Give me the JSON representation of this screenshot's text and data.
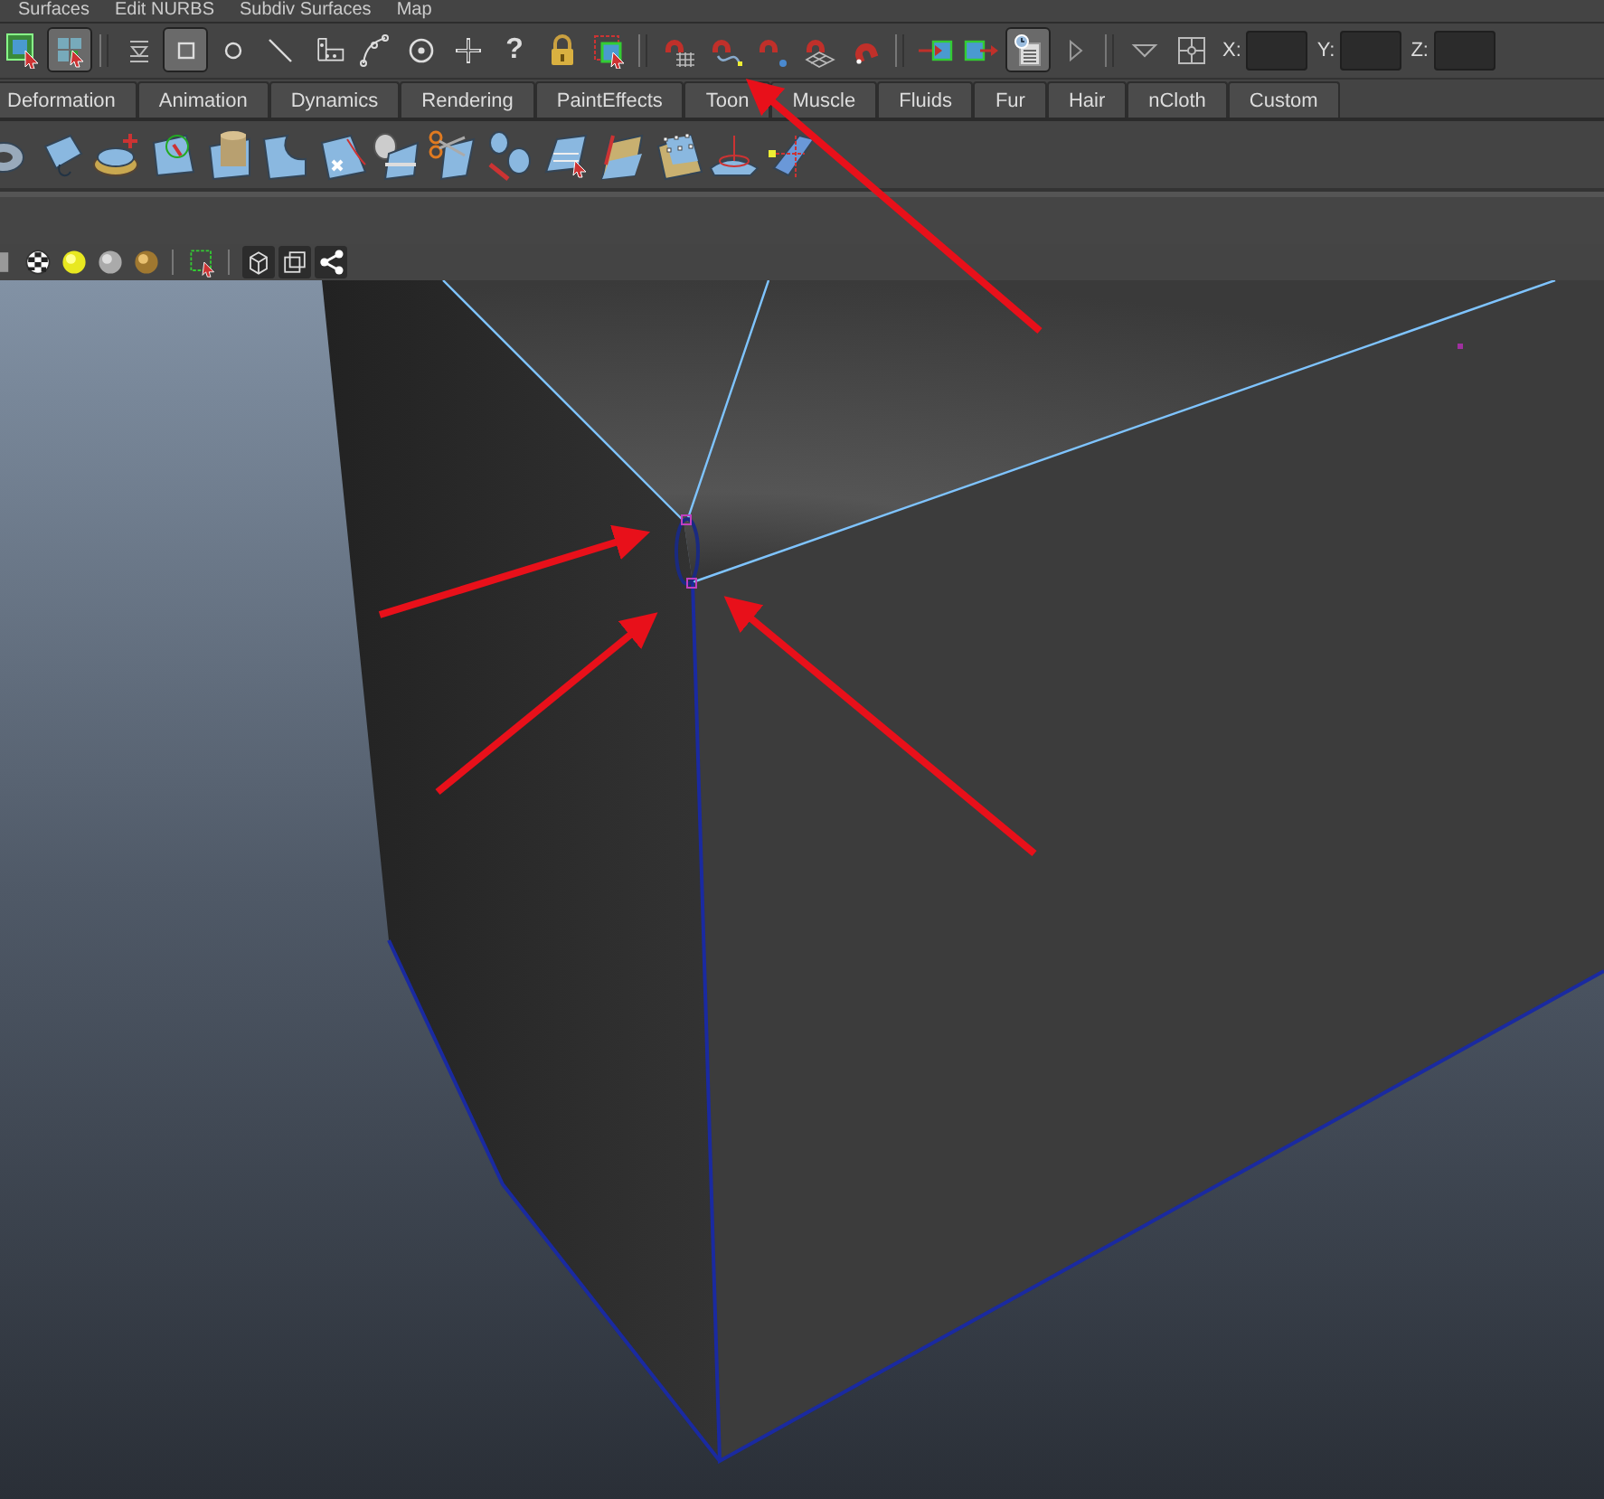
{
  "menu_bar": [
    "Surfaces",
    "Edit NURBS",
    "Subdiv Surfaces",
    "Map"
  ],
  "status_line": {
    "tools": [
      {
        "kind": "partial-select",
        "pressed": false
      },
      {
        "kind": "grid-cursor",
        "pressed": true
      },
      {
        "kind": "separator"
      },
      {
        "kind": "filter-lines",
        "pressed": false
      },
      {
        "kind": "square",
        "pressed": true
      },
      {
        "kind": "circle",
        "pressed": false
      },
      {
        "kind": "diagonal-line",
        "pressed": false
      },
      {
        "kind": "blocks",
        "pressed": false
      },
      {
        "kind": "curve",
        "pressed": false
      },
      {
        "kind": "target",
        "pressed": false
      },
      {
        "kind": "plus",
        "pressed": false
      },
      {
        "kind": "glyph",
        "text": "?",
        "pressed": false
      },
      {
        "kind": "lock",
        "pressed": false
      },
      {
        "kind": "select-box",
        "pressed": false
      },
      {
        "kind": "separator"
      },
      {
        "kind": "magnet-grid",
        "pressed": false
      },
      {
        "kind": "magnet-curve",
        "pressed": false
      },
      {
        "kind": "magnet-point",
        "pressed": false
      },
      {
        "kind": "magnet-plane",
        "pressed": false
      },
      {
        "kind": "magnet",
        "pressed": false
      },
      {
        "kind": "separator"
      },
      {
        "kind": "input-arrow",
        "pressed": false
      },
      {
        "kind": "output-arrow",
        "pressed": false
      },
      {
        "kind": "history",
        "pressed": true
      },
      {
        "kind": "expand-arrow",
        "pressed": false
      },
      {
        "kind": "separator"
      },
      {
        "kind": "triangle-down",
        "pressed": false
      },
      {
        "kind": "crosshair",
        "pressed": false
      }
    ],
    "coordinate_fields": [
      {
        "label": "X:"
      },
      {
        "label": "Y:"
      },
      {
        "label": "Z:"
      }
    ]
  },
  "shelf_tabs": [
    {
      "label": "Deformation",
      "selected": false
    },
    {
      "label": "Animation",
      "selected": false
    },
    {
      "label": "Dynamics",
      "selected": false
    },
    {
      "label": "Rendering",
      "selected": false
    },
    {
      "label": "PaintEffects",
      "selected": false
    },
    {
      "label": "Toon",
      "selected": false
    },
    {
      "label": "Muscle",
      "selected": false
    },
    {
      "label": "Fluids",
      "selected": false
    },
    {
      "label": "Fur",
      "selected": false
    },
    {
      "label": "Hair",
      "selected": false
    },
    {
      "label": "nCloth",
      "selected": false
    },
    {
      "label": "Custom",
      "selected": false
    }
  ]
}
